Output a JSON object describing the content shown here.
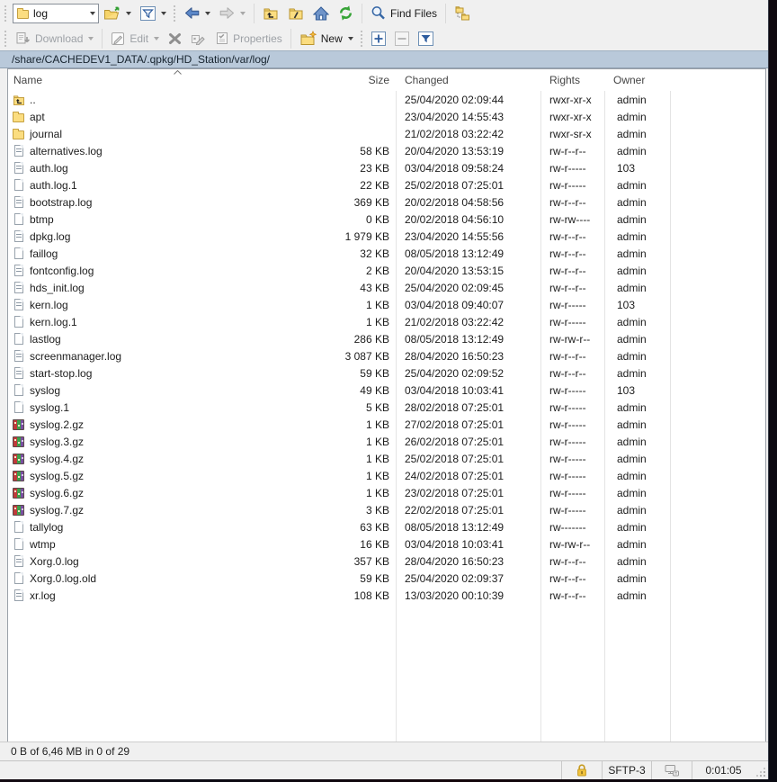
{
  "toolbar_top": {
    "path_combo_value": "log",
    "find_files_label": "Find Files"
  },
  "toolbar_commands": {
    "download_label": "Download",
    "edit_label": "Edit",
    "properties_label": "Properties",
    "new_label": "New"
  },
  "address_bar": {
    "path": "/share/CACHEDEV1_DATA/.qpkg/HD_Station/var/log/"
  },
  "file_table": {
    "columns": [
      "Name",
      "Size",
      "Changed",
      "Rights",
      "Owner"
    ],
    "sort": "name-ascending",
    "rows": [
      {
        "icon": "parent-folder",
        "name": "..",
        "size": "",
        "changed": "25/04/2020 02:09:44",
        "rights": "rwxr-xr-x",
        "owner": "admin"
      },
      {
        "icon": "folder",
        "name": "apt",
        "size": "",
        "changed": "23/04/2020 14:55:43",
        "rights": "rwxr-xr-x",
        "owner": "admin"
      },
      {
        "icon": "folder",
        "name": "journal",
        "size": "",
        "changed": "21/02/2018 03:22:42",
        "rights": "rwxr-sr-x",
        "owner": "admin"
      },
      {
        "icon": "file-lines",
        "name": "alternatives.log",
        "size": "58 KB",
        "changed": "20/04/2020 13:53:19",
        "rights": "rw-r--r--",
        "owner": "admin"
      },
      {
        "icon": "file-lines",
        "name": "auth.log",
        "size": "23 KB",
        "changed": "03/04/2018 09:58:24",
        "rights": "rw-r-----",
        "owner": "103"
      },
      {
        "icon": "file",
        "name": "auth.log.1",
        "size": "22 KB",
        "changed": "25/02/2018 07:25:01",
        "rights": "rw-r-----",
        "owner": "admin"
      },
      {
        "icon": "file-lines",
        "name": "bootstrap.log",
        "size": "369 KB",
        "changed": "20/02/2018 04:58:56",
        "rights": "rw-r--r--",
        "owner": "admin"
      },
      {
        "icon": "file",
        "name": "btmp",
        "size": "0 KB",
        "changed": "20/02/2018 04:56:10",
        "rights": "rw-rw----",
        "owner": "admin"
      },
      {
        "icon": "file-lines",
        "name": "dpkg.log",
        "size": "1 979 KB",
        "changed": "23/04/2020 14:55:56",
        "rights": "rw-r--r--",
        "owner": "admin"
      },
      {
        "icon": "file",
        "name": "faillog",
        "size": "32 KB",
        "changed": "08/05/2018 13:12:49",
        "rights": "rw-r--r--",
        "owner": "admin"
      },
      {
        "icon": "file-lines",
        "name": "fontconfig.log",
        "size": "2 KB",
        "changed": "20/04/2020 13:53:15",
        "rights": "rw-r--r--",
        "owner": "admin"
      },
      {
        "icon": "file-lines",
        "name": "hds_init.log",
        "size": "43 KB",
        "changed": "25/04/2020 02:09:45",
        "rights": "rw-r--r--",
        "owner": "admin"
      },
      {
        "icon": "file-lines",
        "name": "kern.log",
        "size": "1 KB",
        "changed": "03/04/2018 09:40:07",
        "rights": "rw-r-----",
        "owner": "103"
      },
      {
        "icon": "file",
        "name": "kern.log.1",
        "size": "1 KB",
        "changed": "21/02/2018 03:22:42",
        "rights": "rw-r-----",
        "owner": "admin"
      },
      {
        "icon": "file",
        "name": "lastlog",
        "size": "286 KB",
        "changed": "08/05/2018 13:12:49",
        "rights": "rw-rw-r--",
        "owner": "admin"
      },
      {
        "icon": "file-lines",
        "name": "screenmanager.log",
        "size": "3 087 KB",
        "changed": "28/04/2020 16:50:23",
        "rights": "rw-r--r--",
        "owner": "admin"
      },
      {
        "icon": "file-lines",
        "name": "start-stop.log",
        "size": "59 KB",
        "changed": "25/04/2020 02:09:52",
        "rights": "rw-r--r--",
        "owner": "admin"
      },
      {
        "icon": "file",
        "name": "syslog",
        "size": "49 KB",
        "changed": "03/04/2018 10:03:41",
        "rights": "rw-r-----",
        "owner": "103"
      },
      {
        "icon": "file",
        "name": "syslog.1",
        "size": "5 KB",
        "changed": "28/02/2018 07:25:01",
        "rights": "rw-r-----",
        "owner": "admin"
      },
      {
        "icon": "archive",
        "name": "syslog.2.gz",
        "size": "1 KB",
        "changed": "27/02/2018 07:25:01",
        "rights": "rw-r-----",
        "owner": "admin"
      },
      {
        "icon": "archive",
        "name": "syslog.3.gz",
        "size": "1 KB",
        "changed": "26/02/2018 07:25:01",
        "rights": "rw-r-----",
        "owner": "admin"
      },
      {
        "icon": "archive",
        "name": "syslog.4.gz",
        "size": "1 KB",
        "changed": "25/02/2018 07:25:01",
        "rights": "rw-r-----",
        "owner": "admin"
      },
      {
        "icon": "archive",
        "name": "syslog.5.gz",
        "size": "1 KB",
        "changed": "24/02/2018 07:25:01",
        "rights": "rw-r-----",
        "owner": "admin"
      },
      {
        "icon": "archive",
        "name": "syslog.6.gz",
        "size": "1 KB",
        "changed": "23/02/2018 07:25:01",
        "rights": "rw-r-----",
        "owner": "admin"
      },
      {
        "icon": "archive",
        "name": "syslog.7.gz",
        "size": "3 KB",
        "changed": "22/02/2018 07:25:01",
        "rights": "rw-r-----",
        "owner": "admin"
      },
      {
        "icon": "file",
        "name": "tallylog",
        "size": "63 KB",
        "changed": "08/05/2018 13:12:49",
        "rights": "rw-------",
        "owner": "admin"
      },
      {
        "icon": "file",
        "name": "wtmp",
        "size": "16 KB",
        "changed": "03/04/2018 10:03:41",
        "rights": "rw-rw-r--",
        "owner": "admin"
      },
      {
        "icon": "file-lines",
        "name": "Xorg.0.log",
        "size": "357 KB",
        "changed": "28/04/2020 16:50:23",
        "rights": "rw-r--r--",
        "owner": "admin"
      },
      {
        "icon": "file",
        "name": "Xorg.0.log.old",
        "size": "59 KB",
        "changed": "25/04/2020 02:09:37",
        "rights": "rw-r--r--",
        "owner": "admin"
      },
      {
        "icon": "file-lines",
        "name": "xr.log",
        "size": "108 KB",
        "changed": "13/03/2020 00:10:39",
        "rights": "rw-r--r--",
        "owner": "admin"
      }
    ]
  },
  "status_bar": {
    "summary": "0 B of 6,46 MB in 0 of 29"
  },
  "session_bar": {
    "protocol": "SFTP-3",
    "duration": "0:01:05"
  },
  "colors": {
    "address_bar_bg": "#b9c9da",
    "folder_yellow": "#fbdd80",
    "lock_gold": "#f2c33c",
    "accent_blue": "#2d5c9e",
    "refresh_green": "#36a336",
    "toolbar_bg": "#f0f0f0"
  }
}
